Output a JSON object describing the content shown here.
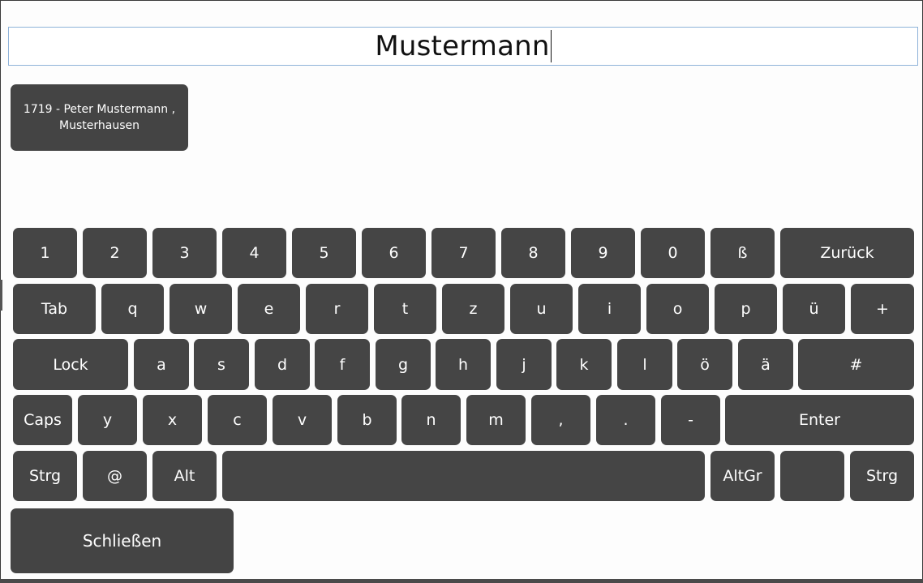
{
  "search": {
    "value": "Mustermann"
  },
  "result": {
    "line1": "1719 - Peter Mustermann ,",
    "line2": "Musterhausen"
  },
  "keyboard": {
    "row1": [
      "1",
      "2",
      "3",
      "4",
      "5",
      "6",
      "7",
      "8",
      "9",
      "0",
      "ß",
      "Zurück"
    ],
    "row2": [
      "Tab",
      "q",
      "w",
      "e",
      "r",
      "t",
      "z",
      "u",
      "i",
      "o",
      "p",
      "ü",
      "+"
    ],
    "row3": [
      "Lock",
      "a",
      "s",
      "d",
      "f",
      "g",
      "h",
      "j",
      "k",
      "l",
      "ö",
      "ä",
      "#"
    ],
    "row4": [
      "Caps",
      "y",
      "x",
      "c",
      "v",
      "b",
      "n",
      "m",
      ",",
      ".",
      "-",
      "Enter"
    ],
    "row5": [
      "Strg",
      "@",
      "Alt",
      "",
      "AltGr",
      "",
      "Strg"
    ]
  },
  "close_label": "Schließen"
}
